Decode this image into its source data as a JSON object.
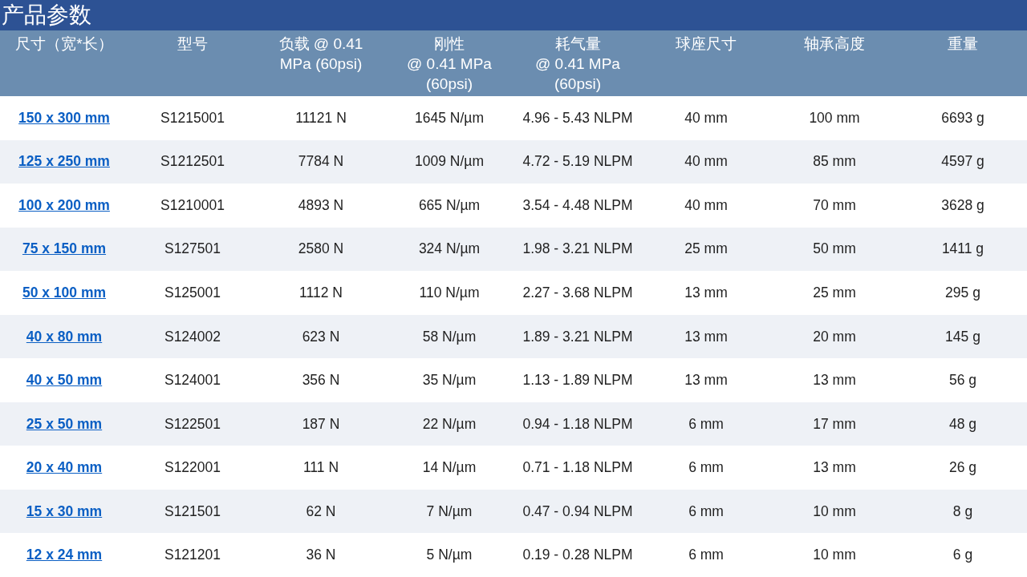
{
  "title": "产品参数",
  "table": {
    "columns": [
      {
        "lines": [
          "尺寸（宽*长）"
        ]
      },
      {
        "lines": [
          "型号"
        ]
      },
      {
        "lines": [
          "负载 @ 0.41",
          "MPa (60psi)"
        ]
      },
      {
        "lines": [
          "刚性",
          "@ 0.41 MPa",
          "(60psi)"
        ]
      },
      {
        "lines": [
          "耗气量",
          "@ 0.41 MPa",
          "(60psi)"
        ]
      },
      {
        "lines": [
          "球座尺寸"
        ]
      },
      {
        "lines": [
          "轴承高度"
        ]
      },
      {
        "lines": [
          "重量"
        ]
      }
    ],
    "rows": [
      [
        "150 x 300 mm",
        "S1215001",
        "11121 N",
        "1645 N/µm",
        "4.96 - 5.43 NLPM",
        "40 mm",
        "100 mm",
        "6693 g"
      ],
      [
        "125 x 250 mm",
        "S1212501",
        "7784 N",
        "1009 N/µm",
        "4.72 - 5.19 NLPM",
        "40 mm",
        "85 mm",
        "4597 g"
      ],
      [
        "100 x 200 mm",
        "S1210001",
        "4893 N",
        "665 N/µm",
        "3.54 - 4.48 NLPM",
        "40 mm",
        "70 mm",
        "3628 g"
      ],
      [
        "75 x 150 mm",
        "S127501",
        "2580 N",
        "324 N/µm",
        "1.98 - 3.21 NLPM",
        "25 mm",
        "50 mm",
        "1411 g"
      ],
      [
        "50 x 100 mm",
        "S125001",
        "1112 N",
        "110 N/µm",
        "2.27 - 3.68 NLPM",
        "13 mm",
        "25 mm",
        "295 g"
      ],
      [
        "40 x 80 mm",
        "S124002",
        "623 N",
        "58 N/µm",
        "1.89 - 3.21 NLPM",
        "13 mm",
        "20 mm",
        "145 g"
      ],
      [
        "40 x 50 mm",
        "S124001",
        "356 N",
        "35 N/µm",
        "1.13 - 1.89 NLPM",
        "13 mm",
        "13 mm",
        "56 g"
      ],
      [
        "25 x 50 mm",
        "S122501",
        "187 N",
        "22 N/µm",
        "0.94 - 1.18 NLPM",
        "6 mm",
        "17 mm",
        "48 g"
      ],
      [
        "20 x 40 mm",
        "S122001",
        "111 N",
        "14 N/µm",
        "0.71 - 1.18 NLPM",
        "6 mm",
        "13 mm",
        "26 g"
      ],
      [
        "15 x 30 mm",
        "S121501",
        "62 N",
        "7 N/µm",
        "0.47 - 0.94 NLPM",
        "6 mm",
        "10 mm",
        "8 g"
      ],
      [
        "12 x 24 mm",
        "S121201",
        "36 N",
        "5 N/µm",
        "0.19 - 0.28 NLPM",
        "6 mm",
        "10 mm",
        "6 g"
      ]
    ]
  }
}
